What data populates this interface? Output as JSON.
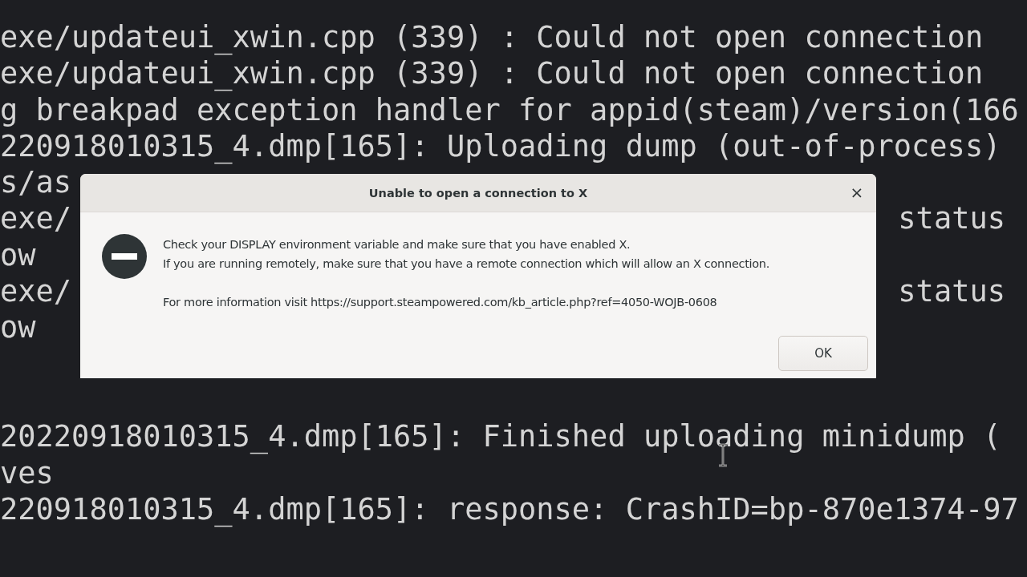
{
  "terminal": {
    "blocks": [
      [
        {
          "left": "exe/updateui_xwin.cpp (339) : Could not open connection"
        },
        {
          "left": "exe/updateui_xwin.cpp (339) : Could not open connection"
        },
        {
          "left": "g breakpad exception handler for appid(steam)/version(166"
        },
        {
          "left": "220918010315_4.dmp[165]: Uploading dump (out-of-process)"
        },
        {
          "left": "s/as"
        },
        {
          "left": "exe/",
          "right": "status"
        },
        {
          "left": "ow"
        },
        {
          "left": "exe/",
          "right": "status"
        },
        {
          "left": "ow"
        }
      ],
      [
        {
          "left": "20220918010315_4.dmp[165]: Finished uploading minidump ("
        },
        {
          "left": "ves"
        },
        {
          "left": "220918010315_4.dmp[165]: response: CrashID=bp-870e1374-97"
        }
      ]
    ]
  },
  "dialog": {
    "title": "Unable to open a connection to X",
    "close": "×",
    "paragraphs": [
      "Check your DISPLAY environment variable and make sure that you have enabled X.\nIf you are running remotely, make sure that you have a remote connection which will allow an X connection.",
      "For more information visit https://support.steampowered.com/kb_article.php?ref=4050-WOJB-0608"
    ],
    "buttons": [
      "OK"
    ]
  }
}
